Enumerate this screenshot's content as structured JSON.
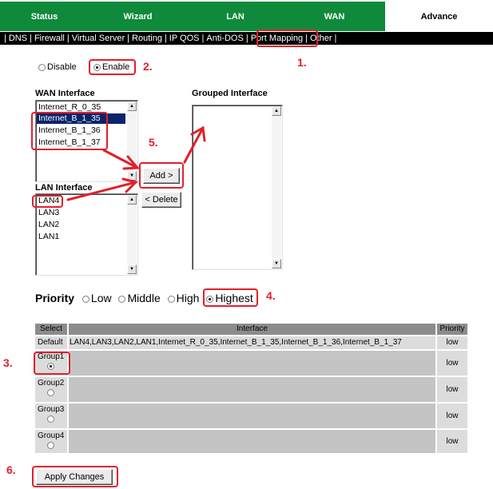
{
  "nav": {
    "tabs": [
      {
        "label": "Status"
      },
      {
        "label": "Wizard"
      },
      {
        "label": "LAN"
      },
      {
        "label": "WAN"
      },
      {
        "label": "Advance"
      }
    ]
  },
  "subnav": {
    "items": [
      "DNS",
      "Firewall",
      "Virtual Server",
      "Routing",
      "IP QOS",
      "Anti-DOS",
      "Port Mapping",
      "Other"
    ]
  },
  "mode": {
    "disable_label": "Disable",
    "enable_label": "Enable",
    "selected": "Enable"
  },
  "wan_interface": {
    "title": "WAN Interface",
    "options": [
      "Internet_R_0_35",
      "Internet_B_1_35",
      "Internet_B_1_36",
      "Internet_B_1_37"
    ],
    "selected": "Internet_B_1_35"
  },
  "lan_interface": {
    "title": "LAN Interface",
    "options": [
      "LAN4",
      "LAN3",
      "LAN2",
      "LAN1"
    ]
  },
  "grouped_interface": {
    "title": "Grouped Interface",
    "options": []
  },
  "buttons": {
    "add": "Add >",
    "delete": "< Delete",
    "apply": "Apply Changes"
  },
  "priority": {
    "label": "Priority",
    "options": [
      "Low",
      "Middle",
      "High",
      "Highest"
    ],
    "selected": "Highest"
  },
  "table": {
    "headers": [
      "Select",
      "Interface",
      "Priority"
    ],
    "rows": [
      {
        "select": "Default",
        "interface": "LAN4,LAN3,LAN2,LAN1,Internet_R_0_35,Internet_B_1_35,Internet_B_1_36,Internet_B_1_37",
        "priority": "low"
      },
      {
        "select": "Group1",
        "interface": "",
        "priority": "low",
        "checked": true
      },
      {
        "select": "Group2",
        "interface": "",
        "priority": "low",
        "checked": false
      },
      {
        "select": "Group3",
        "interface": "",
        "priority": "low",
        "checked": false
      },
      {
        "select": "Group4",
        "interface": "",
        "priority": "low",
        "checked": false
      }
    ]
  },
  "annotations": {
    "step1": "1.",
    "step2": "2.",
    "step3": "3.",
    "step4": "4.",
    "step5": "5.",
    "step6": "6."
  },
  "colors": {
    "tab_green": "#0f8a3a",
    "annotation_red": "#e0202a",
    "selection_blue": "#0a246a"
  }
}
